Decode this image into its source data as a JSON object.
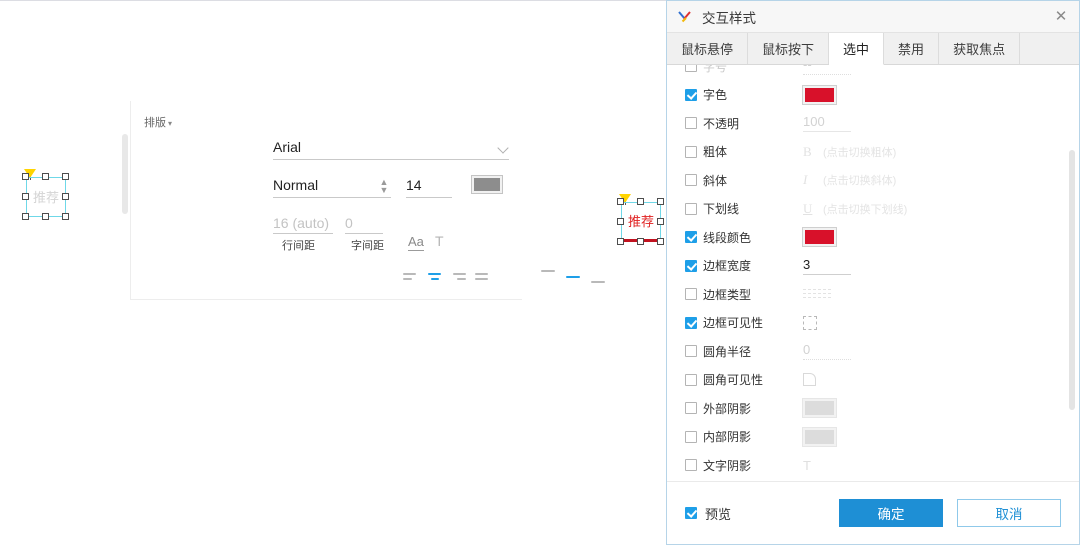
{
  "canvas": {
    "widgets": [
      {
        "name": "widget-left",
        "text": "推荐",
        "text_color": "#d4d4d4",
        "selected": true
      },
      {
        "name": "widget-right",
        "text": "推荐",
        "text_color": "#e02020",
        "selected": true,
        "bottom_border_color": "#c1121f"
      }
    ]
  },
  "left_panel": {
    "title": "排版",
    "caret": "▾",
    "font_family": "Arial",
    "font_weight": "Normal",
    "font_size": "14",
    "font_color_swatch": "#8d8d8d",
    "line_height_placeholder": "16 (auto)",
    "letter_spacing_placeholder": "0",
    "line_height_label": "行间距",
    "letter_spacing_label": "字间距",
    "case_icon": "Aa",
    "text_style_icon": "T",
    "horizontal_alignment": [
      "left",
      "center",
      "right",
      "justify"
    ],
    "horizontal_alignment_active": 1,
    "vertical_alignment": [
      "top",
      "middle",
      "bottom"
    ],
    "vertical_alignment_active": 1
  },
  "dialog": {
    "title": "交互样式",
    "logo_icon": "axure-x-logo-icon",
    "close_icon": "✕",
    "tabs": [
      {
        "label": "鼠标悬停",
        "active": false
      },
      {
        "label": "鼠标按下",
        "active": false
      },
      {
        "label": "选中",
        "active": true
      },
      {
        "label": "禁用",
        "active": false
      },
      {
        "label": "获取焦点",
        "active": false
      }
    ],
    "properties": [
      {
        "name": "font-size",
        "label": "字号",
        "checked": false,
        "dimmed": true,
        "control": "num-ghost-dotted",
        "value": "--"
      },
      {
        "name": "font-color",
        "label": "字色",
        "checked": true,
        "control": "swatch",
        "value": "#d8112a"
      },
      {
        "name": "opacity",
        "label": "不透明",
        "checked": false,
        "control": "num-ghost",
        "value": "100"
      },
      {
        "name": "bold",
        "label": "粗体",
        "checked": false,
        "control": "toggle",
        "glyph": "B",
        "hint": "(点击切换粗体)"
      },
      {
        "name": "italic",
        "label": "斜体",
        "checked": false,
        "control": "toggle",
        "glyph": "I",
        "hint": "(点击切换斜体)"
      },
      {
        "name": "underline",
        "label": "下划线",
        "checked": false,
        "control": "toggle-underline",
        "glyph": "U",
        "hint": "(点击切换下划线)"
      },
      {
        "name": "line-color",
        "label": "线段颜色",
        "checked": true,
        "control": "swatch",
        "value": "#d8112a"
      },
      {
        "name": "border-width",
        "label": "边框宽度",
        "checked": true,
        "control": "num",
        "value": "3"
      },
      {
        "name": "border-style",
        "label": "边框类型",
        "checked": false,
        "control": "dash-lines",
        "value": ""
      },
      {
        "name": "border-visibility",
        "label": "边框可见性",
        "checked": true,
        "control": "dash-box",
        "value": ""
      },
      {
        "name": "corner-radius",
        "label": "圆角半径",
        "checked": false,
        "control": "num-ghost-dotted",
        "value": "0"
      },
      {
        "name": "corner-visibility",
        "label": "圆角可见性",
        "checked": false,
        "control": "corner-icon",
        "value": ""
      },
      {
        "name": "outer-shadow",
        "label": "外部阴影",
        "checked": false,
        "control": "swatch-grey",
        "value": "#dcdcdc"
      },
      {
        "name": "inner-shadow",
        "label": "内部阴影",
        "checked": false,
        "control": "swatch-grey",
        "value": "#dcdcdc"
      },
      {
        "name": "text-shadow",
        "label": "文字阴影",
        "checked": false,
        "control": "text-shadow-icon",
        "value": "T"
      }
    ],
    "footer": {
      "preview_label": "预览",
      "preview_checked": true,
      "ok_label": "确定",
      "cancel_label": "取消"
    }
  }
}
